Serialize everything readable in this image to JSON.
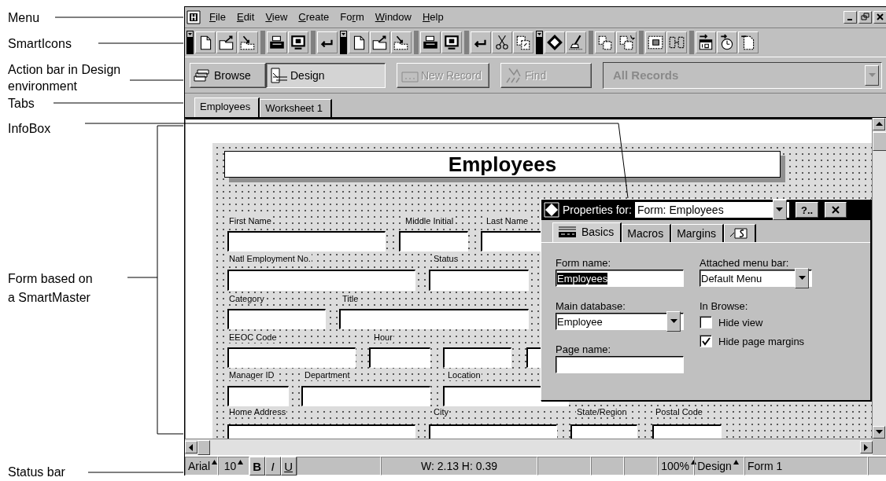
{
  "callouts": [
    {
      "text": "Menu"
    },
    {
      "text": "SmartIcons"
    },
    {
      "text": "Action bar in Design environment"
    },
    {
      "text": "Tabs"
    },
    {
      "text": "InfoBox"
    },
    {
      "text": "Form based on a SmartMaster"
    },
    {
      "text": "Status bar"
    }
  ],
  "menu_bar": {
    "items": [
      {
        "key": "F",
        "post": "ile"
      },
      {
        "key": "E",
        "post": "dit"
      },
      {
        "key": "V",
        "post": "iew"
      },
      {
        "key": "C",
        "post": "reate"
      },
      {
        "pre": "Fo",
        "key": "r",
        "post": "m"
      },
      {
        "key": "W",
        "post": "indow"
      },
      {
        "key": "H",
        "post": "elp"
      }
    ]
  },
  "action_bar": {
    "buttons": [
      {
        "label": "Browse",
        "kind": "browse",
        "selected": false,
        "disabled": false
      },
      {
        "label": "Design",
        "kind": "design",
        "selected": true,
        "disabled": false
      },
      {
        "label": "New Record",
        "kind": "new_record",
        "selected": false,
        "disabled": true
      },
      {
        "label": "Find",
        "kind": "find",
        "selected": false,
        "disabled": true
      }
    ],
    "record_filter": {
      "value": "All Records",
      "disabled": true
    }
  },
  "tabs": [
    {
      "label": "Employees",
      "selected": true
    },
    {
      "label": "Worksheet 1",
      "selected": false
    }
  ],
  "form": {
    "title": "Employees",
    "field_labels": [
      "First Name",
      "Middle Initial",
      "Last Name",
      "Natl Employment No.",
      "Status",
      "Category",
      "Title",
      "EEOC Code",
      "Hour",
      "Manager ID",
      "Department",
      "Location",
      "Home Address",
      "City",
      "State/Region",
      "Postal Code"
    ]
  },
  "infobox": {
    "title": "Properties for:",
    "target": "Form: Employees",
    "help_button": "?..",
    "tabs": [
      {
        "label": "Basics",
        "kind": "icon_label",
        "selected": true
      },
      {
        "label": "Macros",
        "kind": "label",
        "selected": false
      },
      {
        "label": "Margins",
        "kind": "label",
        "selected": false
      },
      {
        "kind": "icon",
        "selected": false
      }
    ],
    "form_name": {
      "label": "Form name:",
      "value": "Employees",
      "selected": true
    },
    "main_database": {
      "label": "Main database:",
      "value": "Employee"
    },
    "page_name": {
      "label": "Page name:"
    },
    "attached_menu": {
      "label": "Attached menu bar:",
      "value": "Default Menu"
    },
    "in_browse": {
      "label": "In Browse:",
      "options": [
        {
          "label": "Hide view",
          "checked": false
        },
        {
          "label": "Hide page margins",
          "checked": true
        }
      ]
    }
  },
  "status_bar": {
    "font": "Arial",
    "size": "10",
    "style_buttons": [
      {
        "label": "B",
        "kind": "bold"
      },
      {
        "label": "I",
        "kind": "italic"
      },
      {
        "label": "U",
        "kind": "underline"
      }
    ],
    "dimensions": "W: 2.13 H: 0.39",
    "zoom": "100%",
    "mode": "Design",
    "page": "Form 1"
  }
}
